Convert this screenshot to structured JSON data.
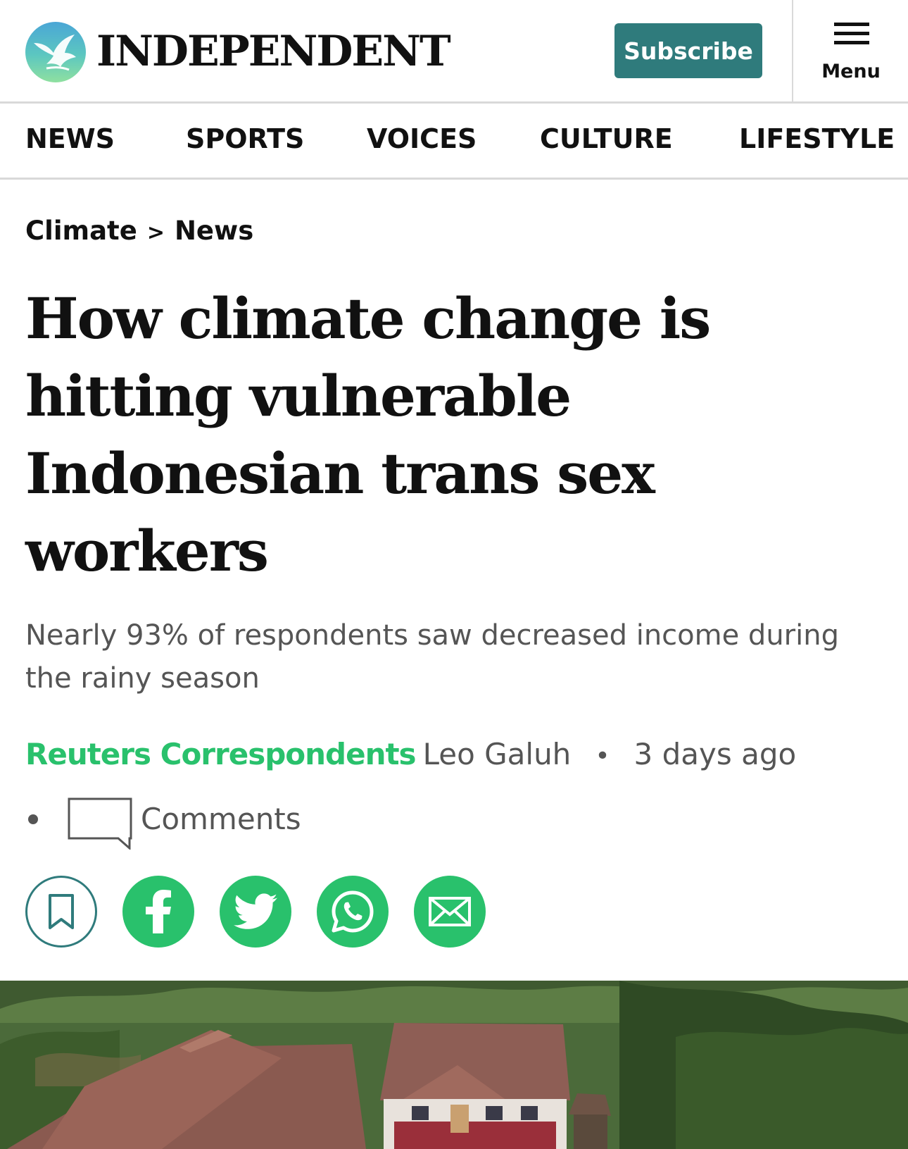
{
  "header": {
    "logo_text": "INDEPENDENT",
    "subscribe_label": "Subscribe",
    "menu_label": "Menu"
  },
  "nav": {
    "items": [
      "NEWS",
      "SPORTS",
      "VOICES",
      "CULTURE",
      "LIFESTYLE"
    ]
  },
  "article": {
    "breadcrumb": [
      "Climate",
      "News"
    ],
    "breadcrumb_separator": ">",
    "headline": "How climate change is hitting vulnerable Indonesian trans sex workers",
    "standfirst": "Nearly 93% of respondents saw decreased income during the rainy season",
    "byline": {
      "agency": "Reuters Correspondents",
      "author": "Leo Galuh",
      "separator": "•",
      "time": "3 days ago"
    },
    "comments_label": "Comments",
    "share_icons": [
      "bookmark-icon",
      "facebook-icon",
      "twitter-icon",
      "whatsapp-icon",
      "email-icon"
    ]
  },
  "colors": {
    "brand_teal": "#2f7b7c",
    "share_green": "#29c16c",
    "agency_green": "#29c16c",
    "divider_gray": "#d9d9d9"
  }
}
